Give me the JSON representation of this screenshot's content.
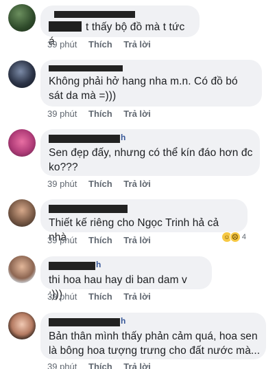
{
  "comments": [
    {
      "name_suffix": "",
      "text": "t thấy bộ đồ mà t tức á",
      "time": "39 phút",
      "like": "Thích",
      "reply": "Trả lời"
    },
    {
      "name_suffix": "",
      "text": "Không phải hở hang nha m.n. Có đồ bó sát da mà =)))",
      "time": "39 phút",
      "like": "Thích",
      "reply": "Trả lời"
    },
    {
      "name_suffix": "h",
      "text": "Sen đẹp đấy, nhưng có thể kín đáo hơn đc ko???",
      "time": "39 phút",
      "like": "Thích",
      "reply": "Trả lời"
    },
    {
      "name_suffix": "",
      "text": "Thiết kế riêng cho Ngọc Trinh hả cả nhà",
      "time": "39 phút",
      "like": "Thích",
      "reply": "Trả lời",
      "reaction_count": "4"
    },
    {
      "name_suffix": "h",
      "text": "thi hoa hau hay di ban dam v :)))",
      "time": "39 phút",
      "like": "Thích",
      "reply": "Trả lời"
    },
    {
      "name_suffix": "h",
      "text": "Bản thân mình thấy phản cảm quá, hoa sen là bông hoa tượng trưng cho đất nước mà...",
      "time": "39 phút",
      "like": "Thích",
      "reply": "Trả lời"
    }
  ],
  "icons": {
    "reaction_1": "haha-emoji-icon",
    "reaction_2": "sad-emoji-icon"
  },
  "colors": {
    "bubble": "#f0f1f4",
    "meta_text": "#606770",
    "body_text": "#1c1e21"
  }
}
